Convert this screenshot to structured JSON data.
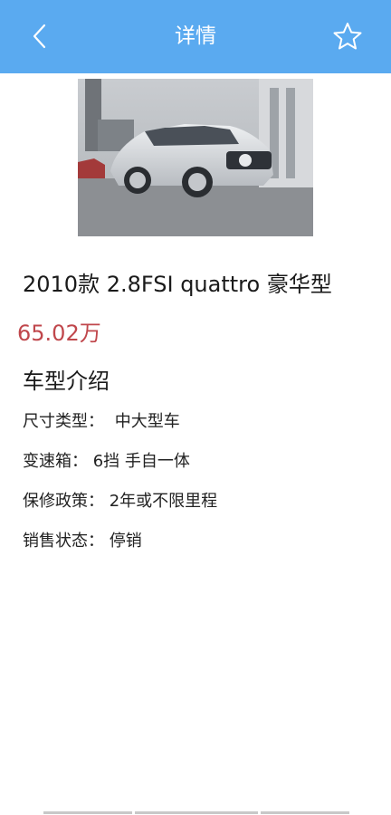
{
  "header": {
    "title": "详情",
    "back_icon": "chevron-left-icon",
    "favorite_icon": "star-outline-icon",
    "background_color": "#5aaaf0"
  },
  "car": {
    "image_alt": "car photo",
    "name": "2010款 2.8FSI quattro 豪华型",
    "price": "65.02万",
    "price_color": "#c0474c"
  },
  "intro": {
    "section_title": "车型介绍",
    "specs": [
      {
        "label": "尺寸类型：",
        "value": "中大型车"
      },
      {
        "label": "变速箱：",
        "value": "6挡 手自一体"
      },
      {
        "label": "保修政策：",
        "value": "2年或不限里程"
      },
      {
        "label": "销售状态：",
        "value": "停销"
      }
    ]
  }
}
